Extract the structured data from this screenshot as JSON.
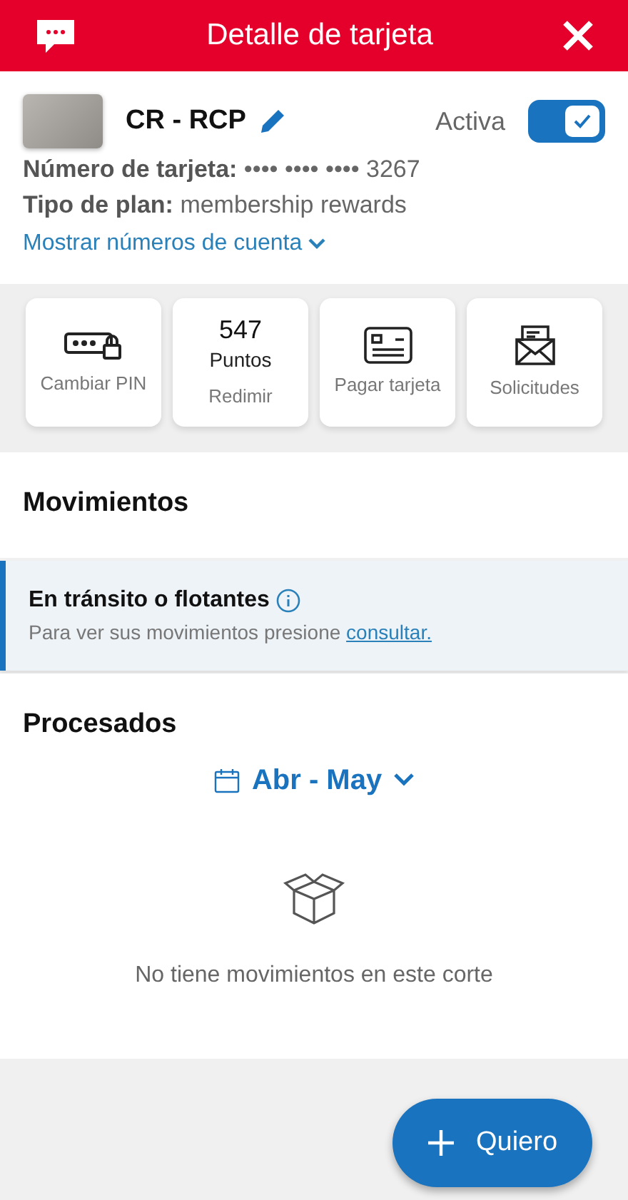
{
  "header": {
    "title": "Detalle de tarjeta"
  },
  "card": {
    "name": "CR - RCP",
    "status_label": "Activa",
    "active": true,
    "details": [
      {
        "label": "Número de tarjeta:",
        "value": "•••• •••• •••• 3267"
      },
      {
        "label": "Tipo de plan:",
        "value": "membership rewards"
      }
    ],
    "show_accounts_link": "Mostrar números de cuenta"
  },
  "actions": [
    {
      "kind": "pin",
      "label": "Cambiar PIN"
    },
    {
      "kind": "points",
      "value": "547",
      "unit": "Puntos",
      "label": "Redimir"
    },
    {
      "kind": "pay",
      "label": "Pagar tarjeta"
    },
    {
      "kind": "requests",
      "label": "Solicitudes"
    }
  ],
  "movements": {
    "title": "Movimientos",
    "transit": {
      "title": "En tránsito o flotantes",
      "text": "Para ver sus movimientos presione",
      "link": "consultar."
    },
    "processed": {
      "title": "Procesados",
      "period": "Abr - May",
      "empty_text": "No tiene movimientos en este corte"
    }
  },
  "fab": {
    "label": "Quiero"
  }
}
